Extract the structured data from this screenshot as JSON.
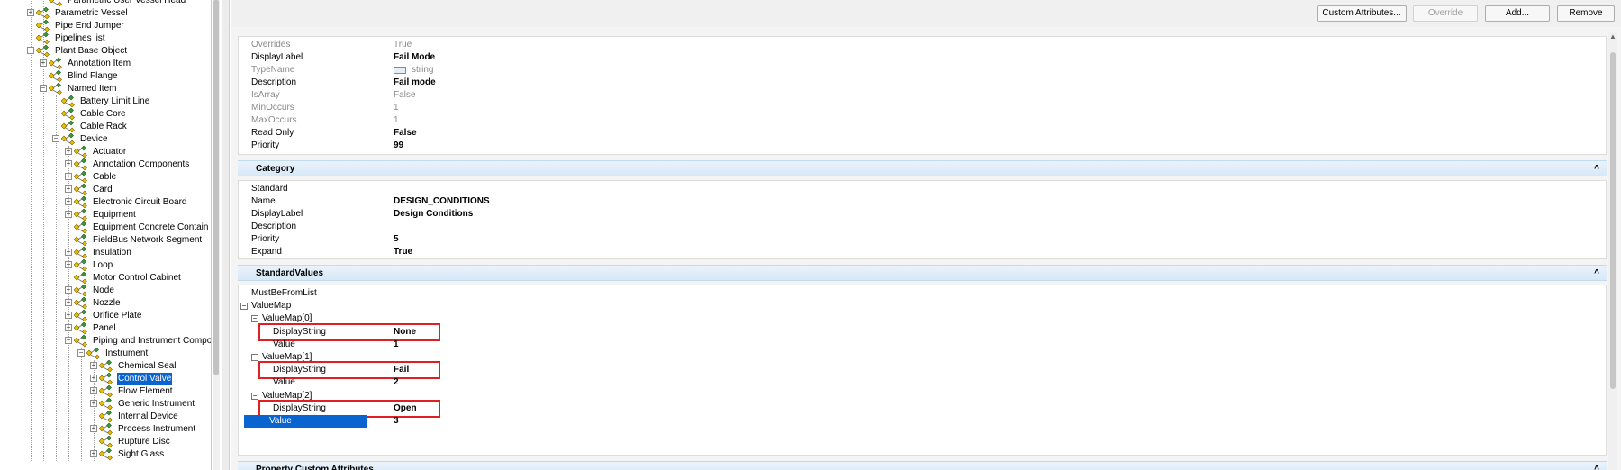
{
  "tree": {
    "nodes": [
      {
        "label": "Parametric User Vessel Head",
        "depth": 2,
        "toggle": "",
        "cut": true
      },
      {
        "label": "Parametric Vessel",
        "depth": 1,
        "toggle": "+"
      },
      {
        "label": "Pipe End Jumper",
        "depth": 1,
        "toggle": ""
      },
      {
        "label": "Pipelines list",
        "depth": 1,
        "toggle": ""
      },
      {
        "label": "Plant Base Object",
        "depth": 1,
        "toggle": "-"
      },
      {
        "label": "Annotation Item",
        "depth": 2,
        "toggle": "+"
      },
      {
        "label": "Blind Flange",
        "depth": 2,
        "toggle": ""
      },
      {
        "label": "Named Item",
        "depth": 2,
        "toggle": "-"
      },
      {
        "label": "Battery Limit Line",
        "depth": 3,
        "toggle": ""
      },
      {
        "label": "Cable Core",
        "depth": 3,
        "toggle": ""
      },
      {
        "label": "Cable Rack",
        "depth": 3,
        "toggle": ""
      },
      {
        "label": "Device",
        "depth": 3,
        "toggle": "-"
      },
      {
        "label": "Actuator",
        "depth": 4,
        "toggle": "+"
      },
      {
        "label": "Annotation Components",
        "depth": 4,
        "toggle": "+"
      },
      {
        "label": "Cable",
        "depth": 4,
        "toggle": "+"
      },
      {
        "label": "Card",
        "depth": 4,
        "toggle": "+"
      },
      {
        "label": "Electronic Circuit Board",
        "depth": 4,
        "toggle": "+"
      },
      {
        "label": "Equipment",
        "depth": 4,
        "toggle": "+"
      },
      {
        "label": "Equipment Concrete Contain",
        "depth": 4,
        "toggle": ""
      },
      {
        "label": "FieldBus Network Segment",
        "depth": 4,
        "toggle": ""
      },
      {
        "label": "Insulation",
        "depth": 4,
        "toggle": "+"
      },
      {
        "label": "Loop",
        "depth": 4,
        "toggle": "+"
      },
      {
        "label": "Motor Control Cabinet",
        "depth": 4,
        "toggle": ""
      },
      {
        "label": "Node",
        "depth": 4,
        "toggle": "+"
      },
      {
        "label": "Nozzle",
        "depth": 4,
        "toggle": "+"
      },
      {
        "label": "Orifice Plate",
        "depth": 4,
        "toggle": "+"
      },
      {
        "label": "Panel",
        "depth": 4,
        "toggle": "+"
      },
      {
        "label": "Piping and Instrument Compo",
        "depth": 4,
        "toggle": "-"
      },
      {
        "label": "Instrument",
        "depth": 5,
        "toggle": "-"
      },
      {
        "label": "Chemical Seal",
        "depth": 6,
        "toggle": "+"
      },
      {
        "label": "Control Valve",
        "depth": 6,
        "toggle": "+",
        "selected": true
      },
      {
        "label": "Flow Element",
        "depth": 6,
        "toggle": "+"
      },
      {
        "label": "Generic Instrument",
        "depth": 6,
        "toggle": "+"
      },
      {
        "label": "Internal Device",
        "depth": 6,
        "toggle": ""
      },
      {
        "label": "Process Instrument",
        "depth": 6,
        "toggle": "+"
      },
      {
        "label": "Rupture Disc",
        "depth": 6,
        "toggle": ""
      },
      {
        "label": "Sight Glass",
        "depth": 6,
        "toggle": "+"
      }
    ]
  },
  "toolbar": {
    "custom_attributes": "Custom Attributes...",
    "override": "Override",
    "add": "Add...",
    "remove": "Remove"
  },
  "property_box": {
    "rows": [
      {
        "name": "Overrides",
        "value": "True",
        "dim": true
      },
      {
        "name": "DisplayLabel",
        "value": "Fail Mode"
      },
      {
        "name": "TypeName",
        "value": "string",
        "dim": true,
        "icon": true
      },
      {
        "name": "Description",
        "value": "Fail mode"
      },
      {
        "name": "IsArray",
        "value": "False",
        "dim": true
      },
      {
        "name": "MinOccurs",
        "value": "1",
        "dim": true
      },
      {
        "name": "MaxOccurs",
        "value": "1",
        "dim": true
      },
      {
        "name": "Read Only",
        "value": "False"
      },
      {
        "name": "Priority",
        "value": "99"
      }
    ]
  },
  "category": {
    "title": "Category",
    "rows": [
      {
        "name": "Standard",
        "value": ""
      },
      {
        "name": "Name",
        "value": "DESIGN_CONDITIONS"
      },
      {
        "name": "DisplayLabel",
        "value": "Design Conditions"
      },
      {
        "name": "Description",
        "value": ""
      },
      {
        "name": "Priority",
        "value": "5"
      },
      {
        "name": "Expand",
        "value": "True"
      }
    ]
  },
  "standard_values": {
    "title": "StandardValues",
    "rows": [
      {
        "name": "MustBeFromList",
        "value": "",
        "indent": 0
      },
      {
        "name": "ValueMap",
        "value": "",
        "indent": 0,
        "toggle": "-"
      },
      {
        "name": "ValueMap[0]",
        "value": "",
        "indent": 1,
        "toggle": "-"
      },
      {
        "name": "DisplayString",
        "value": "None",
        "indent": 2,
        "boxed": true
      },
      {
        "name": "Value",
        "value": "1",
        "indent": 2
      },
      {
        "name": "ValueMap[1]",
        "value": "",
        "indent": 1,
        "toggle": "-"
      },
      {
        "name": "DisplayString",
        "value": "Fail",
        "indent": 2,
        "boxed": true
      },
      {
        "name": "Value",
        "value": "2",
        "indent": 2
      },
      {
        "name": "ValueMap[2]",
        "value": "",
        "indent": 1,
        "toggle": "-"
      },
      {
        "name": "DisplayString",
        "value": "Open",
        "indent": 2,
        "boxed": true
      },
      {
        "name": "Value",
        "value": "3",
        "indent": 2,
        "selected": true
      }
    ]
  },
  "custom_attributes_section": {
    "title": "Property Custom Attributes"
  },
  "icons": {
    "chevron_up": "^",
    "tree_node_icon": "class-node-icon"
  },
  "colors": {
    "selection": "#0a64d0",
    "highlight_box": "#e02020",
    "category_header": "#d6e8f7",
    "node_icon_yellow": "#e8c000",
    "node_icon_green": "#3a9a3a"
  }
}
